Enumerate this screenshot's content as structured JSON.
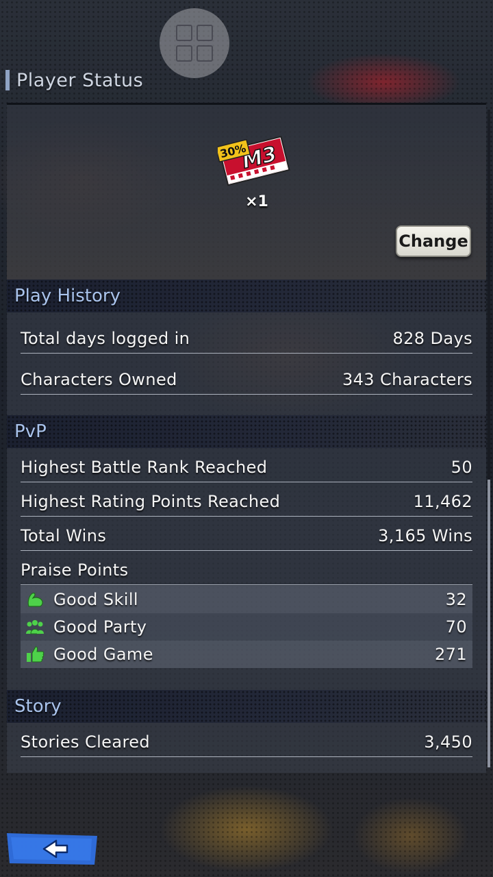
{
  "header": {
    "title": "Player Status",
    "menu_icon": "grid-menu-icon"
  },
  "featured_item": {
    "badge_text": "30%",
    "logo_text": "M3",
    "count": "×1",
    "change_label": "Change"
  },
  "play_history": {
    "title": "Play History",
    "rows": [
      {
        "label": "Total days logged in",
        "value": "828 Days"
      },
      {
        "label": "Characters Owned",
        "value": "343 Characters"
      }
    ]
  },
  "pvp": {
    "title": "PvP",
    "rows": [
      {
        "label": "Highest Battle Rank Reached",
        "value": "50"
      },
      {
        "label": "Highest Rating Points Reached",
        "value": "11,462"
      },
      {
        "label": "Total Wins",
        "value": "3,165 Wins"
      }
    ],
    "praise_title": "Praise Points",
    "praise": [
      {
        "label": "Good Skill",
        "value": "32",
        "icon": "muscle-icon"
      },
      {
        "label": "Good Party",
        "value": "70",
        "icon": "party-icon"
      },
      {
        "label": "Good Game",
        "value": "271",
        "icon": "thumbs-up-icon"
      }
    ]
  },
  "story": {
    "title": "Story",
    "rows": [
      {
        "label": "Stories Cleared",
        "value": "3,450"
      }
    ]
  },
  "footer": {
    "back_icon": "back-arrow-icon"
  },
  "colors": {
    "section_title": "#a9c3ec",
    "praise_icon": "#4ed14a",
    "back_button": "#2f6fe0"
  }
}
